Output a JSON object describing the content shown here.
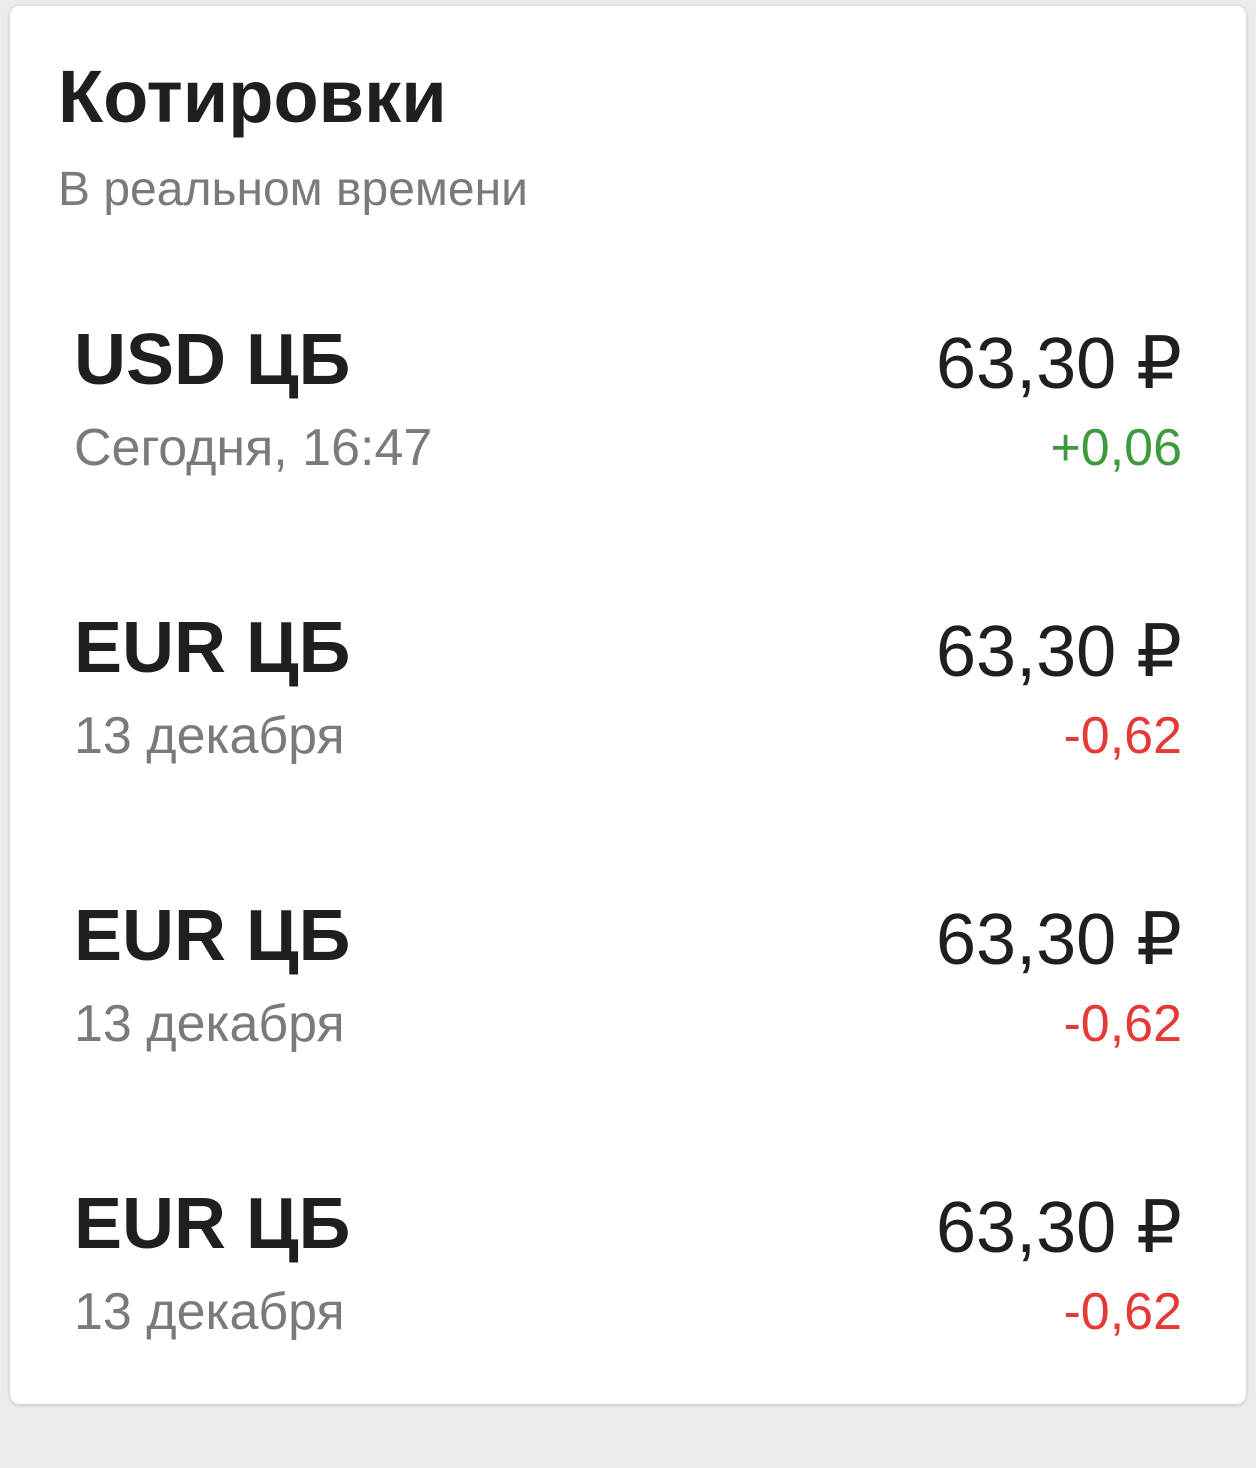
{
  "header": {
    "title": "Котировки",
    "subtitle": "В реальном времени"
  },
  "colors": {
    "positive": "#3d9a3d",
    "negative": "#e53935"
  },
  "quotes": [
    {
      "name": "USD ЦБ",
      "date": "Сегодня, 16:47",
      "price": "63,30 ₽",
      "change": "+0,06",
      "direction": "positive"
    },
    {
      "name": "EUR ЦБ",
      "date": "13 декабря",
      "price": "63,30 ₽",
      "change": "-0,62",
      "direction": "negative"
    },
    {
      "name": "EUR ЦБ",
      "date": "13 декабря",
      "price": "63,30 ₽",
      "change": "-0,62",
      "direction": "negative"
    },
    {
      "name": "EUR ЦБ",
      "date": "13 декабря",
      "price": "63,30 ₽",
      "change": "-0,62",
      "direction": "negative"
    }
  ]
}
